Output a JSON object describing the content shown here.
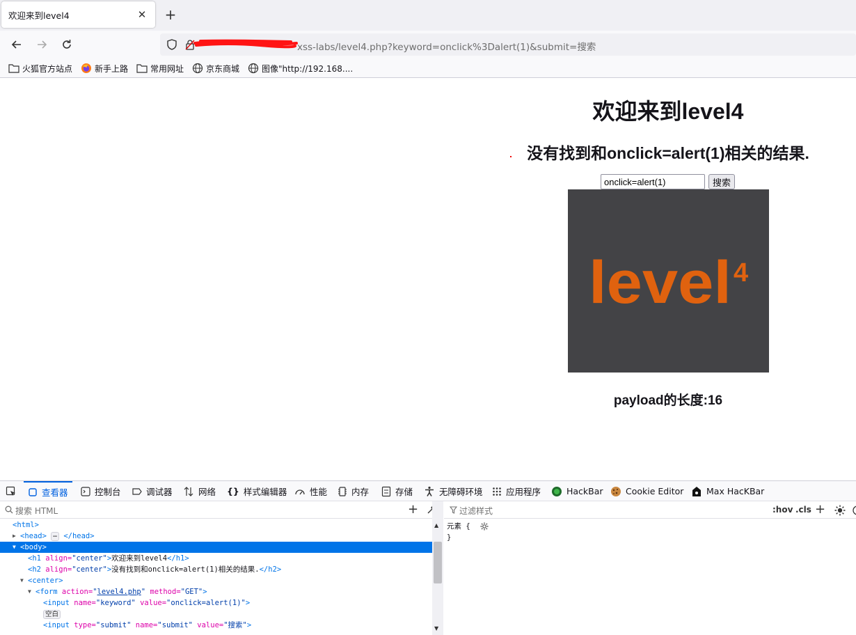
{
  "browser": {
    "tab_title": "欢迎来到level4",
    "url_visible": "xss-labs/level4.php?keyword=onclick%3Dalert(1)&submit=搜索",
    "bookmarks": [
      {
        "label": "火狐官方站点",
        "icon": "folder-icon"
      },
      {
        "label": "新手上路",
        "icon": "firefox-icon"
      },
      {
        "label": "常用网址",
        "icon": "folder-icon"
      },
      {
        "label": "京东商城",
        "icon": "globe-icon"
      },
      {
        "label": "图像\"http://192.168....",
        "icon": "globe-icon"
      }
    ]
  },
  "page": {
    "heading": "欢迎来到level4",
    "result": "没有找到和onclick=alert(1)相关的结果.",
    "search_value": "onclick=alert(1)",
    "search_button": "搜索",
    "image_text": "level",
    "image_sup": "4",
    "payload_text": "payload的长度:16",
    "colors": {
      "image_bg": "#434346",
      "logo_orange": "#e0620f"
    }
  },
  "devtools": {
    "tabs": [
      {
        "label": "查看器",
        "icon": "inspector-icon",
        "active": true
      },
      {
        "label": "控制台",
        "icon": "console-icon"
      },
      {
        "label": "调试器",
        "icon": "debugger-icon"
      },
      {
        "label": "网络",
        "icon": "network-icon"
      },
      {
        "label": "样式编辑器",
        "icon": "style-editor-icon"
      },
      {
        "label": "性能",
        "icon": "performance-icon"
      },
      {
        "label": "内存",
        "icon": "memory-icon"
      },
      {
        "label": "存储",
        "icon": "storage-icon"
      },
      {
        "label": "无障碍环境",
        "icon": "accessibility-icon"
      },
      {
        "label": "应用程序",
        "icon": "application-icon"
      },
      {
        "label": "HackBar",
        "icon": "hackbar-icon"
      },
      {
        "label": "Cookie Editor",
        "icon": "cookie-icon"
      },
      {
        "label": "Max HacKBar",
        "icon": "max-hackbar-icon"
      }
    ],
    "html_search_placeholder": "搜索 HTML",
    "styles_filter_placeholder": "过滤样式",
    "hov": ":hov",
    "cls": ".cls",
    "rule_selector": "元素 {",
    "rule_close": "}",
    "tree": {
      "html_open": "<html>",
      "head_open": "<head>",
      "head_ellipsis": "⋯",
      "head_close": "</head>",
      "body_open": "<body>",
      "h1_tag": "<h1",
      "h1_attr": " align=",
      "h1_val": "\"center\"",
      "h1_gt": ">",
      "h1_text": "欢迎来到level4",
      "h1_close": "</h1>",
      "h2_tag": "<h2",
      "h2_attr": " align=",
      "h2_val": "\"center\"",
      "h2_gt": ">",
      "h2_text": "没有找到和onclick=alert(1)相关的结果.",
      "h2_close": "</h2>",
      "center_open": "<center>",
      "form_tag": "<form",
      "form_attr1": " action=",
      "form_q1": "\"",
      "form_action": "level4.php",
      "form_q2": "\"",
      "form_attr2": " method=",
      "form_method": "\"GET\"",
      "form_gt": ">",
      "input_tag": "<input",
      "input_attr1": " name=",
      "input_name": "\"keyword\"",
      "input_attr2": " value=",
      "input_value": "\"onclick=alert(1)\"",
      "input_gt": ">",
      "whitespace_badge": "空白",
      "submit_tag": "<input",
      "submit_attr1": " type=",
      "submit_type": "\"submit\"",
      "submit_attr2": " name=",
      "submit_name": "\"submit\"",
      "submit_attr3": " value=",
      "submit_value": "\"搜索\"",
      "submit_gt": ">"
    }
  }
}
